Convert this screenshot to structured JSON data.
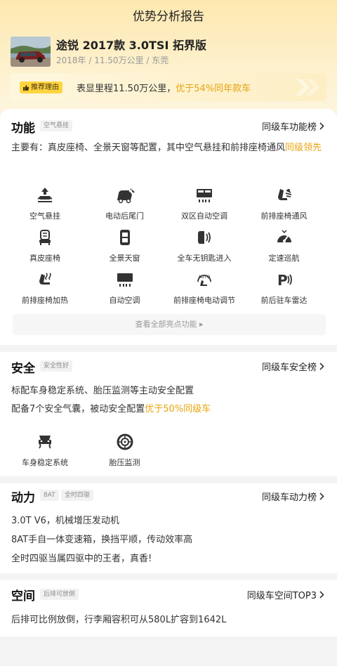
{
  "page": {
    "title": "优势分析报告"
  },
  "car": {
    "name": "途锐 2017款 3.0TSI 拓界版",
    "meta": "2018年 / 11.50万公里 / 东莞",
    "thumb_icon": "car-photo"
  },
  "reason": {
    "tag": "推荐理由",
    "text_prefix": "表显里程11.50万公里，",
    "text_highlight": "优于54%同年款车"
  },
  "function": {
    "title": "功能",
    "tag": "空气悬挂",
    "rank_link": "同级车功能榜",
    "desc_prefix": "主要有：真皮座椅、全景天窗等配置，其中空气悬挂和前排座椅通风",
    "desc_highlight": "同级领先",
    "features": [
      {
        "label": "空气悬挂",
        "icon": "air-suspension-icon"
      },
      {
        "label": "电动后尾门",
        "icon": "power-tailgate-icon"
      },
      {
        "label": "双区自动空调",
        "icon": "dual-zone-ac-icon"
      },
      {
        "label": "前排座椅通风",
        "icon": "seat-ventilation-icon"
      },
      {
        "label": "真皮座椅",
        "icon": "leather-seat-icon"
      },
      {
        "label": "全景天窗",
        "icon": "panoramic-sunroof-icon"
      },
      {
        "label": "全车无钥匙进入",
        "icon": "keyless-entry-icon"
      },
      {
        "label": "定速巡航",
        "icon": "cruise-control-icon"
      },
      {
        "label": "前排座椅加热",
        "icon": "seat-heating-icon"
      },
      {
        "label": "自动空调",
        "icon": "auto-ac-icon"
      },
      {
        "label": "前排座椅电动调节",
        "icon": "power-seat-adjust-icon"
      },
      {
        "label": "前后驻车雷达",
        "icon": "parking-radar-icon"
      }
    ],
    "see_all": "查看全部亮点功能 ▸"
  },
  "safety": {
    "title": "安全",
    "tag": "安全性好",
    "rank_link": "同级车安全榜",
    "line1": "标配车身稳定系统、胎压监测等主动安全配置",
    "line2_prefix": "配备7个安全气囊，被动安全配置",
    "line2_highlight": "优于50%同级车",
    "features": [
      {
        "label": "车身稳定系统",
        "icon": "stability-control-icon"
      },
      {
        "label": "胎压监测",
        "icon": "tire-pressure-icon"
      }
    ]
  },
  "power": {
    "title": "动力",
    "tags": [
      "8AT",
      "全时四驱"
    ],
    "rank_link": "同级车动力榜",
    "lines": [
      "3.0T V6，机械增压发动机",
      "8AT手自一体变速箱，换挡平顺，传动效率高",
      "全时四驱当属四驱中的王者，真香!"
    ]
  },
  "space": {
    "title": "空间",
    "tag": "后排可放倒",
    "rank_link": "同级车空间TOP3",
    "line": "后排可比例放倒，行李厢容积可从580L扩容到1642L"
  },
  "colors": {
    "accent": "#e8a40d",
    "tag_yellow": "#ffd53f",
    "header_bg": "#fde8b0"
  }
}
